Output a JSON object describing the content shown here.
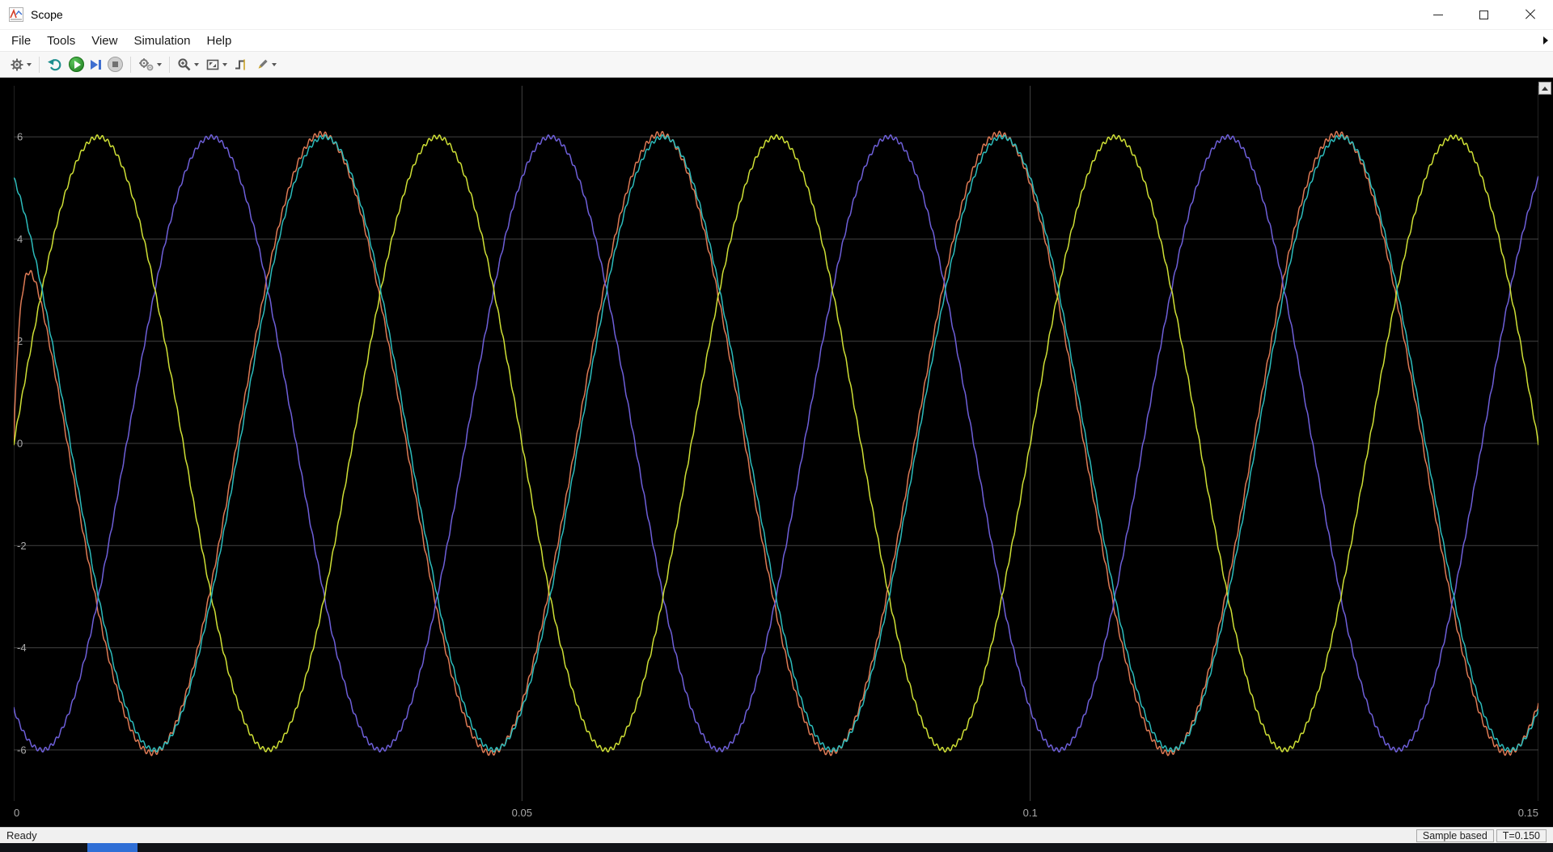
{
  "window": {
    "title": "Scope"
  },
  "menu": {
    "items": [
      "File",
      "Tools",
      "View",
      "Simulation",
      "Help"
    ]
  },
  "toolbar": {
    "icons": [
      "configuration-properties-gear-icon",
      "step-back-icon",
      "run-icon",
      "step-forward-icon",
      "stop-icon",
      "style-gears-icon",
      "zoom-icon",
      "fit-to-view-icon",
      "triggers-icon",
      "measurements-pencil-icon"
    ]
  },
  "statusbar": {
    "status": "Ready",
    "panels": [
      "Sample based",
      "T=0.150"
    ]
  },
  "colors": {
    "taskbar_accent": "#2f6fd6",
    "plot_background": "#000000"
  },
  "chart_data": {
    "type": "line",
    "xlim": [
      0,
      0.15
    ],
    "ylim": [
      -7,
      7
    ],
    "x_ticks": [
      0,
      0.05,
      0.1,
      0.15
    ],
    "x_tick_labels": [
      "0",
      "0.05",
      "0.1",
      "0.15"
    ],
    "y_ticks": [
      -6,
      -4,
      -2,
      0,
      2,
      4,
      6
    ],
    "y_tick_labels": [
      "-6",
      "-4",
      "-2",
      "0",
      "2",
      "4",
      "6"
    ],
    "grid": true,
    "background": "#000000",
    "grid_color": "#424242",
    "axis_text_color": "#a8a8a8",
    "sample_count": 2600,
    "series": [
      {
        "name": "trace-orange-measured",
        "color": "#dd7a55",
        "type": "sine",
        "amplitude": 6.06,
        "frequency_hz": 30,
        "phase_deg": 123,
        "rise_tau_s": 0.0008,
        "ripple": {
          "amplitude": 0.05,
          "frequency_hz": 1900
        }
      },
      {
        "name": "trace-violet",
        "color": "#6e5fd9",
        "type": "sine",
        "amplitude": 6,
        "frequency_hz": 30,
        "phase_deg": -120,
        "ripple": {
          "amplitude": 0.04,
          "frequency_hz": 1900
        }
      },
      {
        "name": "trace-yellow",
        "color": "#cfe035",
        "type": "sine",
        "amplitude": 6,
        "frequency_hz": 30,
        "phase_deg": 0,
        "ripple": {
          "amplitude": 0.04,
          "frequency_hz": 1900
        }
      },
      {
        "name": "trace-teal",
        "color": "#2cbcbc",
        "type": "sine",
        "amplitude": 6,
        "frequency_hz": 30,
        "phase_deg": 120,
        "ripple": {
          "amplitude": 0.04,
          "frequency_hz": 1900
        }
      }
    ]
  }
}
